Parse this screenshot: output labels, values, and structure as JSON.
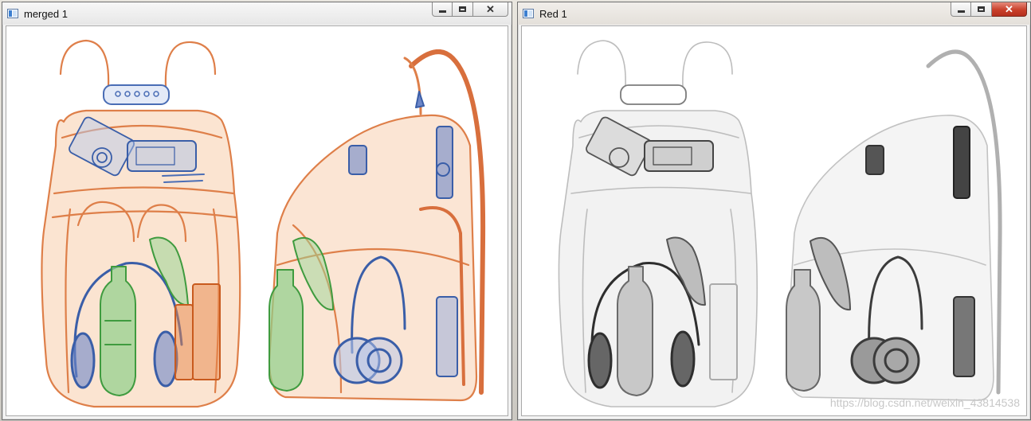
{
  "windows": {
    "left": {
      "title": "merged 1",
      "controls": {
        "minimize": "minimize",
        "maximize": "maximize",
        "close": "close"
      }
    },
    "right": {
      "title": "Red 1",
      "controls": {
        "minimize": "minimize",
        "maximize": "maximize",
        "close": "close"
      }
    }
  },
  "watermark": "https://blog.csdn.net/weixin_43814538",
  "icons": [
    "app-icon",
    "minimize-icon",
    "maximize-icon",
    "close-icon"
  ],
  "colors": {
    "organic_orange": "#d9692a",
    "metal_blue": "#3a5ea8",
    "inorganic_green": "#4fa84a",
    "gray_channel": "#3b3b3b",
    "close_button_red": "#c9402b"
  }
}
